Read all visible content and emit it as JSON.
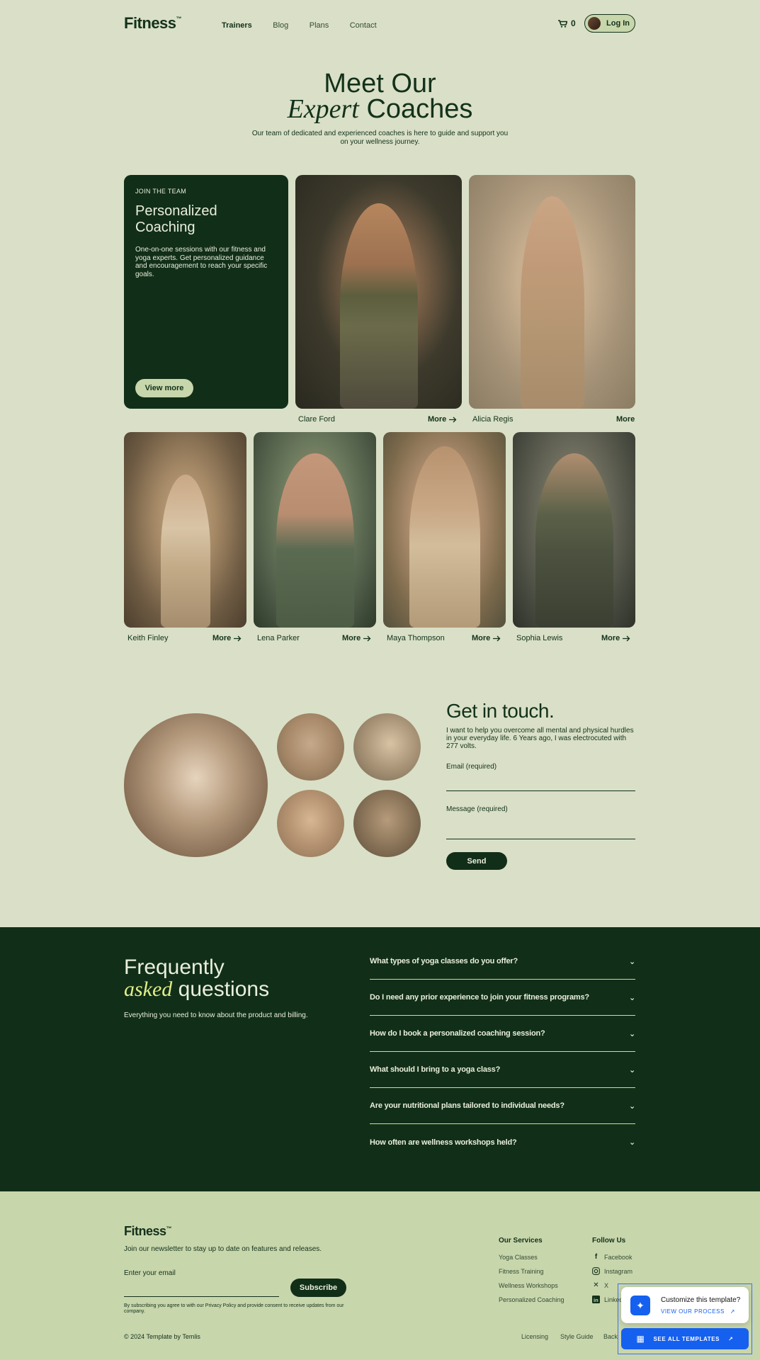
{
  "header": {
    "logo": "Fitness",
    "logo_mark": "™",
    "nav": [
      "Trainers",
      "Blog",
      "Plans",
      "Contact"
    ],
    "cart_count": "0",
    "login_label": "Log In"
  },
  "hero": {
    "title_line1": "Meet Our",
    "title_em": "Expert",
    "title_rest": "Coaches",
    "subtitle_line1": "Our team of dedicated and experienced coaches is here to guide and support you",
    "subtitle_line2": "on your wellness journey."
  },
  "feature_card": {
    "kicker": "JOIN THE TEAM",
    "title": "Personalized Coaching",
    "desc": "One-on-one sessions with our fitness and yoga experts. Get personalized guidance and encouragement to reach your specific goals.",
    "button": "View more"
  },
  "coaches_top": [
    {
      "name": "Clare Ford",
      "more": "More"
    },
    {
      "name": "Alicia Regis",
      "more": "More"
    }
  ],
  "coaches_bottom": [
    {
      "name": "Keith Finley",
      "more": "More"
    },
    {
      "name": "Lena Parker",
      "more": "More"
    },
    {
      "name": "Maya Thompson",
      "more": "More"
    },
    {
      "name": "Sophia Lewis",
      "more": "More"
    }
  ],
  "contact": {
    "title": "Get in touch.",
    "desc": "I want to help you overcome all mental and physical hurdles in your everyday life. 6 Years ago, I was electrocuted with 277 volts.",
    "email_label": "Email (required)",
    "message_label": "Message (required)",
    "send_label": "Send"
  },
  "faq": {
    "title_line1": "Frequently",
    "title_em": "asked",
    "title_rest": "questions",
    "subtitle": "Everything you need to know about the product and billing.",
    "items": [
      "What types of yoga classes do you offer?",
      "Do I need any prior experience to join your fitness programs?",
      "How do I book a personalized coaching session?",
      "What should I bring to a yoga class?",
      "Are your nutritional plans tailored to individual needs?",
      "How often are wellness workshops held?"
    ]
  },
  "footer": {
    "logo": "Fitness",
    "logo_mark": "™",
    "newsletter": "Join our newsletter to stay up to date on features and releases.",
    "email_placeholder": "Enter your email",
    "subscribe": "Subscribe",
    "consent": "By subscribing you agree to with our Privacy Policy and provide consent to receive updates from our company.",
    "services_title": "Our Services",
    "services": [
      "Yoga Classes",
      "Fitness Training",
      "Wellness Workshops",
      "Personalized Coaching"
    ],
    "follow_title": "Follow Us",
    "social": [
      "Facebook",
      "Instagram",
      "X",
      "LinkedIn"
    ],
    "copyright": "© 2024 Template by Temlis",
    "bottom_links": [
      "Licensing",
      "Style Guide",
      "Back"
    ]
  },
  "widget": {
    "title": "Customize this template?",
    "link": "VIEW OUR PROCESS",
    "button": "SEE ALL TEMPLATES"
  },
  "colors": {
    "background": "#d9e0c7",
    "dark_green": "#112e18",
    "lime_accent": "#e2ee88",
    "footer_bg": "#c8d6ac",
    "widget_blue": "#1560ef"
  },
  "icons": [
    "cart-icon",
    "avatar-icon",
    "arrow-right-icon",
    "chevron-down-icon",
    "facebook-icon",
    "instagram-icon",
    "x-icon",
    "linkedin-icon",
    "wand-icon",
    "template-icon",
    "external-arrow-icon"
  ]
}
